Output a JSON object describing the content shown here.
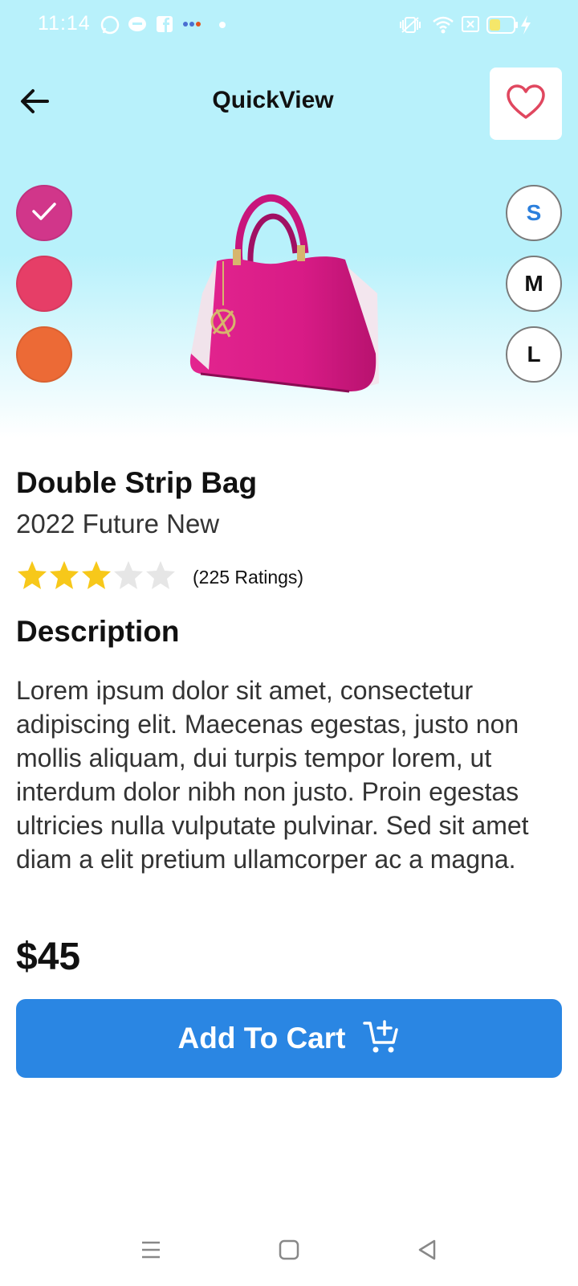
{
  "status_bar": {
    "time": "11:14",
    "icons": [
      "whatsapp-icon",
      "message-icon",
      "facebook-icon",
      "more-dots-icon",
      "dot-icon",
      "vibrate-icon",
      "wifi-icon",
      "sim-icon",
      "battery-icon",
      "charging-icon"
    ],
    "battery_level": 0.45
  },
  "header": {
    "title": "QuickView",
    "back_icon": "arrow-left-icon",
    "favorite_icon": "heart-outline-icon"
  },
  "colors": {
    "hero_bg": "#b8f1fb",
    "accent": "#2a86e3",
    "star_filled": "#f7c81a",
    "star_empty": "#e6e6e6",
    "heart": "#e0475f"
  },
  "color_options": [
    {
      "name": "magenta",
      "hex": "#d1368a",
      "selected": true
    },
    {
      "name": "red",
      "hex": "#e63e67",
      "selected": false
    },
    {
      "name": "orange",
      "hex": "#ec6a36",
      "selected": false
    }
  ],
  "sizes": [
    {
      "label": "S",
      "selected": true
    },
    {
      "label": "M",
      "selected": false
    },
    {
      "label": "L",
      "selected": false
    }
  ],
  "product": {
    "name": "Double Strip Bag",
    "subtitle": "2022 Future New",
    "rating": 3,
    "rating_max": 5,
    "ratings_count": "(225 Ratings)",
    "description_heading": "Description",
    "description": "Lorem ipsum dolor sit amet, consectetur adipiscing elit. Maecenas egestas, justo non mollis aliquam, dui turpis tempor lorem, ut interdum dolor nibh non justo. Proin egestas ultricies nulla vulputate pulvinar. Sed sit amet diam a elit pretium ullamcorper ac a magna.",
    "price": "$45"
  },
  "cta": {
    "label": "Add To Cart",
    "icon": "cart-plus-icon"
  },
  "nav_bar": {
    "icons": [
      "menu-icon",
      "home-square-icon",
      "back-triangle-icon"
    ]
  }
}
